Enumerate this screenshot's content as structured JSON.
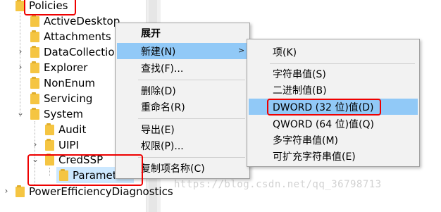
{
  "tree": {
    "items": [
      {
        "label": "Policies"
      },
      {
        "label": "ActiveDesktop"
      },
      {
        "label": "Attachments"
      },
      {
        "label": "DataCollection"
      },
      {
        "label": "Explorer"
      },
      {
        "label": "NonEnum"
      },
      {
        "label": "Servicing"
      },
      {
        "label": "System"
      },
      {
        "label": "Audit"
      },
      {
        "label": "UIPI"
      },
      {
        "label": "CredSSP"
      },
      {
        "label": "Parameters"
      },
      {
        "label": "PowerEfficiencyDiagnostics"
      }
    ]
  },
  "context_menu": {
    "expand": "展开",
    "new": "新建(N)",
    "find": "查找(F)...",
    "delete": "删除(D)",
    "rename": "重命名(R)",
    "export": "导出(E)",
    "permissions": "权限(P)...",
    "copy_key_name": "复制项名称(C)"
  },
  "submenu": {
    "key": "项(K)",
    "string_value": "字符串值(S)",
    "binary_value": "二进制值(B)",
    "dword_value": "DWORD (32 位)值(D)",
    "qword_value": "QWORD (64 位)值(Q)",
    "multi_string_value": "多字符串值(M)",
    "expandable_string_value": "可扩充字符串值(E)"
  },
  "watermark": "https://blog.csdn.net/qq_36798713",
  "colors": {
    "highlight": "#91c9f7",
    "selection": "#cce8ff",
    "annotation": "#ee0000",
    "folder": "#f5c542"
  }
}
